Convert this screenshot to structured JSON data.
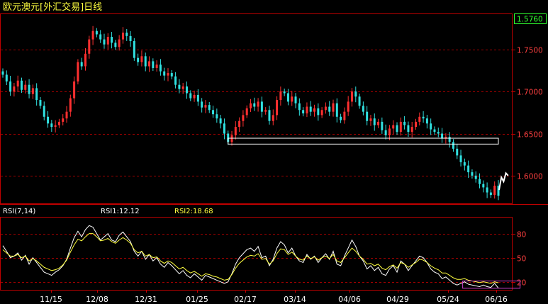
{
  "title": "欧元澳元[外汇交易]日线",
  "price_badge": "1.5760",
  "colors": {
    "background": "#000000",
    "frame": "#c00000",
    "grid": "#a00000",
    "up": "#ff3030",
    "down": "#30e0e0",
    "label": "#ff4040",
    "title": "#ffff40",
    "badge_text": "#30ff30",
    "rsi1": "#ffffff",
    "rsi2": "#ffff40",
    "box": "#ffffff",
    "rsi_box": "#d040d0"
  },
  "chart_data": [
    {
      "type": "candlestick",
      "name": "price",
      "yticks": [
        "1.7500",
        "1.7000",
        "1.6500",
        "1.6000"
      ],
      "ytick_values": [
        1.75,
        1.7,
        1.65,
        1.6
      ],
      "ylim": [
        1.567,
        1.792
      ],
      "xticks": [
        "11/15",
        "12/08",
        "12/31",
        "01/25",
        "02/17",
        "03/14",
        "04/06",
        "04/29",
        "05/24",
        "06/16"
      ],
      "last_value": 1.576,
      "close_path": [
        1.72,
        1.712,
        1.7,
        1.706,
        1.713,
        1.702,
        1.708,
        1.697,
        1.704,
        1.69,
        1.683,
        1.67,
        1.662,
        1.658,
        1.66,
        1.664,
        1.668,
        1.676,
        1.692,
        1.712,
        1.735,
        1.73,
        1.745,
        1.762,
        1.772,
        1.768,
        1.762,
        1.756,
        1.765,
        1.758,
        1.753,
        1.762,
        1.77,
        1.766,
        1.76,
        1.74,
        1.735,
        1.742,
        1.73,
        1.736,
        1.728,
        1.732,
        1.724,
        1.719,
        1.722,
        1.718,
        1.708,
        1.703,
        1.706,
        1.698,
        1.692,
        1.696,
        1.688,
        1.681,
        1.684,
        1.678,
        1.673,
        1.668,
        1.662,
        1.65,
        1.64,
        1.648,
        1.658,
        1.665,
        1.672,
        1.68,
        1.686,
        1.682,
        1.688,
        1.676,
        1.678,
        1.665,
        1.672,
        1.69,
        1.7,
        1.698,
        1.688,
        1.694,
        1.686,
        1.678,
        1.674,
        1.682,
        1.676,
        1.68,
        1.672,
        1.678,
        1.682,
        1.676,
        1.686,
        1.67,
        1.666,
        1.676,
        1.688,
        1.7,
        1.694,
        1.683,
        1.676,
        1.665,
        1.668,
        1.66,
        1.664,
        1.654,
        1.648,
        1.656,
        1.66,
        1.652,
        1.664,
        1.66,
        1.652,
        1.658,
        1.664,
        1.67,
        1.668,
        1.662,
        1.655,
        1.652,
        1.65,
        1.644,
        1.646,
        1.64,
        1.632,
        1.624,
        1.616,
        1.612,
        1.604,
        1.6,
        1.596,
        1.59,
        1.586,
        1.58,
        1.577,
        1.588,
        1.576
      ],
      "tail_line": [
        1.583,
        1.598,
        1.593,
        1.603,
        1.6
      ],
      "annotation_box": {
        "x_start_index": 60,
        "x_end_index": 132,
        "y_top": 1.6445,
        "y_bottom": 1.6375
      }
    },
    {
      "type": "line",
      "name": "RSI(7,14)",
      "label": "RSI(7,14)",
      "ylim": [
        10,
        100
      ],
      "yticks": [
        "80",
        "50",
        "20"
      ],
      "ytick_values": [
        80,
        50,
        20
      ],
      "series": [
        {
          "name": "RSI1",
          "label": "RSI1:12.12",
          "values": [
            65,
            58,
            50,
            52,
            56,
            47,
            53,
            42,
            50,
            44,
            38,
            32,
            30,
            28,
            32,
            35,
            40,
            48,
            62,
            75,
            83,
            76,
            85,
            90,
            88,
            80,
            72,
            76,
            80,
            72,
            70,
            78,
            82,
            76,
            70,
            58,
            52,
            58,
            48,
            54,
            46,
            50,
            42,
            38,
            44,
            40,
            35,
            30,
            34,
            28,
            25,
            30,
            26,
            22,
            28,
            26,
            24,
            22,
            20,
            18,
            20,
            30,
            42,
            50,
            55,
            60,
            62,
            58,
            64,
            50,
            52,
            40,
            48,
            62,
            70,
            66,
            56,
            62,
            52,
            46,
            44,
            54,
            48,
            52,
            44,
            50,
            55,
            48,
            58,
            42,
            40,
            52,
            62,
            72,
            64,
            52,
            46,
            36,
            40,
            34,
            38,
            30,
            28,
            36,
            40,
            32,
            46,
            42,
            34,
            40,
            46,
            52,
            50,
            44,
            36,
            32,
            30,
            24,
            26,
            22,
            18,
            16,
            18,
            20,
            17,
            16,
            15,
            14,
            16,
            14,
            13,
            18,
            12.12
          ]
        },
        {
          "name": "RSI2",
          "label": "RSI2:18.68",
          "values": [
            60,
            56,
            52,
            52,
            54,
            50,
            52,
            46,
            49,
            46,
            42,
            38,
            36,
            34,
            35,
            37,
            41,
            47,
            57,
            66,
            73,
            71,
            76,
            80,
            80,
            76,
            71,
            72,
            74,
            70,
            68,
            72,
            75,
            72,
            68,
            60,
            56,
            58,
            52,
            54,
            50,
            51,
            46,
            43,
            46,
            44,
            40,
            36,
            38,
            34,
            31,
            33,
            30,
            27,
            30,
            29,
            27,
            26,
            24,
            22,
            23,
            29,
            37,
            43,
            47,
            51,
            53,
            52,
            55,
            48,
            49,
            42,
            46,
            55,
            61,
            60,
            54,
            57,
            52,
            48,
            47,
            52,
            49,
            51,
            47,
            50,
            52,
            49,
            54,
            46,
            44,
            50,
            56,
            62,
            58,
            52,
            48,
            42,
            43,
            40,
            42,
            37,
            35,
            39,
            41,
            37,
            44,
            42,
            38,
            41,
            44,
            48,
            47,
            44,
            40,
            37,
            35,
            31,
            31,
            28,
            25,
            23,
            23,
            24,
            22,
            21,
            20,
            19,
            20,
            19,
            18,
            20,
            18.68
          ]
        }
      ],
      "annotation_box": {
        "x_start_index": 124,
        "x_end_index": 134,
        "y_top": 21,
        "y_bottom": 12
      }
    }
  ]
}
